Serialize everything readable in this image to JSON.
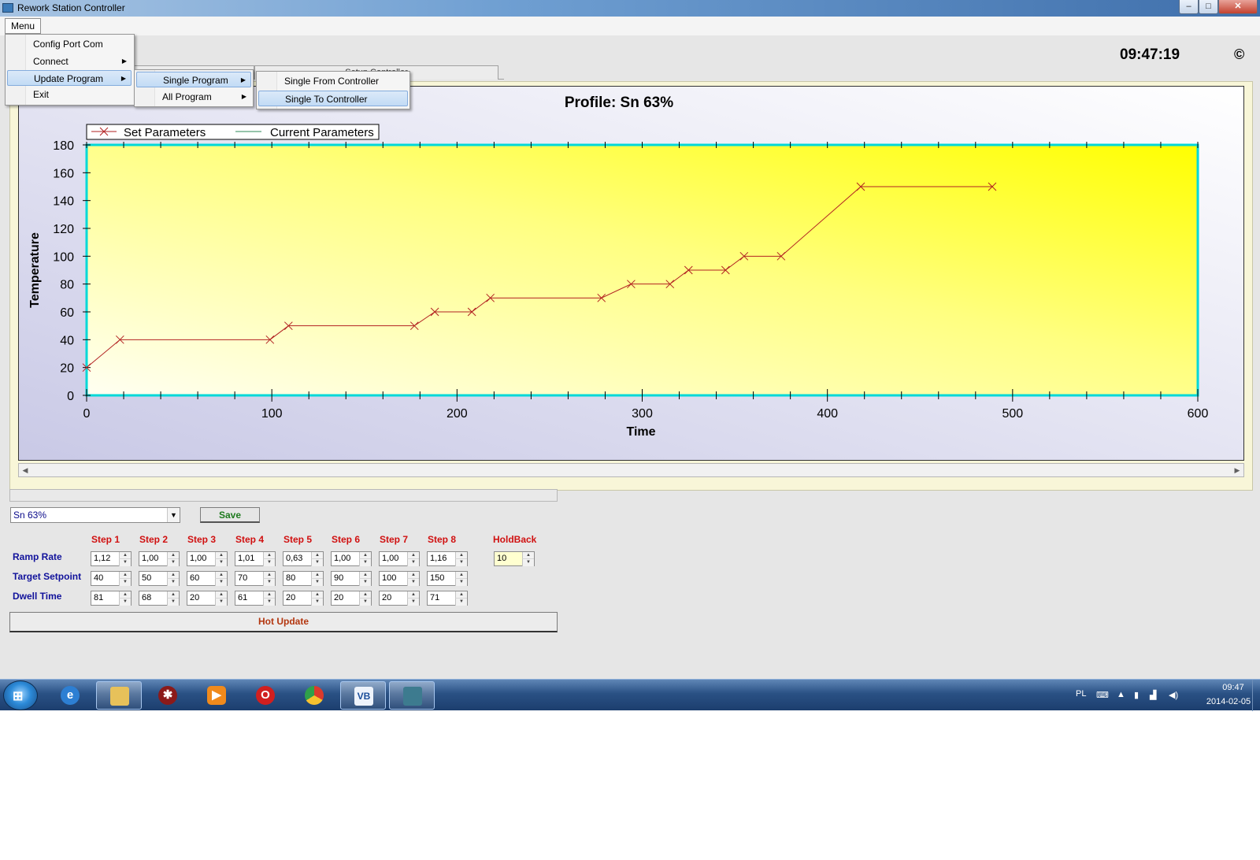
{
  "window": {
    "title": "Rework Station Controller",
    "minimize": "–",
    "maximize": "□",
    "close": "✕"
  },
  "menubar": {
    "root_label": "Menu"
  },
  "clock": "09:47:19",
  "copyright_symbol": "©",
  "tabs": [
    "",
    "Setup Controller"
  ],
  "menus": {
    "main": [
      {
        "label": "Config Port Com",
        "submenu": false
      },
      {
        "label": "Connect",
        "submenu": true
      },
      {
        "label": "Update Program",
        "submenu": true,
        "highlighted": true
      },
      {
        "label": "Exit",
        "submenu": false
      }
    ],
    "update_program": [
      {
        "label": "Single Program",
        "submenu": true,
        "highlighted": true
      },
      {
        "label": "All Program",
        "submenu": true
      }
    ],
    "single_program": [
      {
        "label": "Single From Controller"
      },
      {
        "label": "Single To Controller",
        "highlighted": true
      }
    ]
  },
  "chart_data": {
    "type": "line",
    "title": "Profile: Sn 63%",
    "xlabel": "Time",
    "ylabel": "Temperature",
    "xlim": [
      0,
      600
    ],
    "ylim": [
      0,
      180
    ],
    "x_ticks": [
      0,
      100,
      200,
      300,
      400,
      500,
      600
    ],
    "y_ticks": [
      0,
      20,
      40,
      60,
      80,
      100,
      120,
      140,
      160,
      180
    ],
    "legend": [
      "Set Parameters",
      "Current Parameters"
    ],
    "legend_position": "top-left",
    "series": [
      {
        "name": "Set Parameters",
        "color": "#b22222",
        "marker": "x",
        "x": [
          0,
          18,
          99,
          109,
          177,
          188,
          208,
          218,
          278,
          294,
          315,
          325,
          345,
          355,
          375,
          418,
          489
        ],
        "y": [
          20,
          40,
          40,
          50,
          50,
          60,
          60,
          70,
          70,
          80,
          80,
          90,
          90,
          100,
          100,
          150,
          150
        ]
      },
      {
        "name": "Current Parameters",
        "color": "#2e8b57",
        "x": [],
        "y": []
      }
    ]
  },
  "controls": {
    "profile_select": "Sn 63%",
    "save_label": "Save",
    "hot_update_label": "Hot Update",
    "holdback_label": "HoldBack",
    "holdback_value": "10",
    "row_labels": [
      "Ramp Rate",
      "Target Setpoint",
      "Dwell Time"
    ],
    "steps": [
      {
        "label": "Step 1",
        "ramp": "1,12",
        "target": "40",
        "dwell": "81"
      },
      {
        "label": "Step 2",
        "ramp": "1,00",
        "target": "50",
        "dwell": "68"
      },
      {
        "label": "Step 3",
        "ramp": "1,00",
        "target": "60",
        "dwell": "20"
      },
      {
        "label": "Step 4",
        "ramp": "1,01",
        "target": "70",
        "dwell": "61"
      },
      {
        "label": "Step 5",
        "ramp": "0,63",
        "target": "80",
        "dwell": "20"
      },
      {
        "label": "Step 6",
        "ramp": "1,00",
        "target": "90",
        "dwell": "20"
      },
      {
        "label": "Step 7",
        "ramp": "1,00",
        "target": "100",
        "dwell": "20"
      },
      {
        "label": "Step 8",
        "ramp": "1,16",
        "target": "150",
        "dwell": "71"
      }
    ]
  },
  "taskbar": {
    "items": [
      "internet-explorer",
      "file-explorer",
      "bug-app",
      "media-player",
      "opera",
      "chrome",
      "visual-basic",
      "rework-station"
    ],
    "language": "PL",
    "time": "09:47",
    "date": "2014-02-05"
  }
}
